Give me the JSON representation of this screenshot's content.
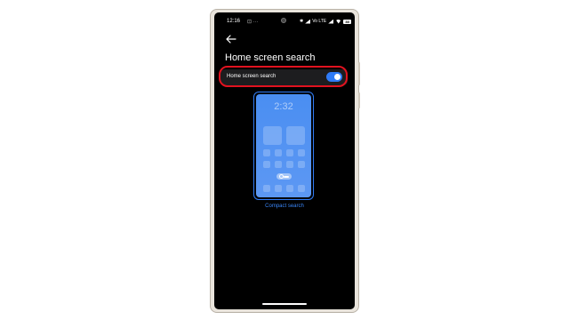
{
  "status_bar": {
    "time": "12:16",
    "dots": "⊡ ···",
    "volte": "Vo LTE",
    "battery": "80",
    "icons": [
      "bluetooth-icon",
      "signal-icon",
      "wifi-icon",
      "battery-icon"
    ]
  },
  "header": {
    "back_icon": "arrow-left-icon",
    "title": "Home screen search"
  },
  "setting": {
    "label": "Home screen search",
    "enabled": true,
    "accent": "#2f7bf6",
    "highlight_color": "#e1121f"
  },
  "preview": {
    "clock": "2:32",
    "caption": "Compact search",
    "background": "#4a8ef2"
  }
}
